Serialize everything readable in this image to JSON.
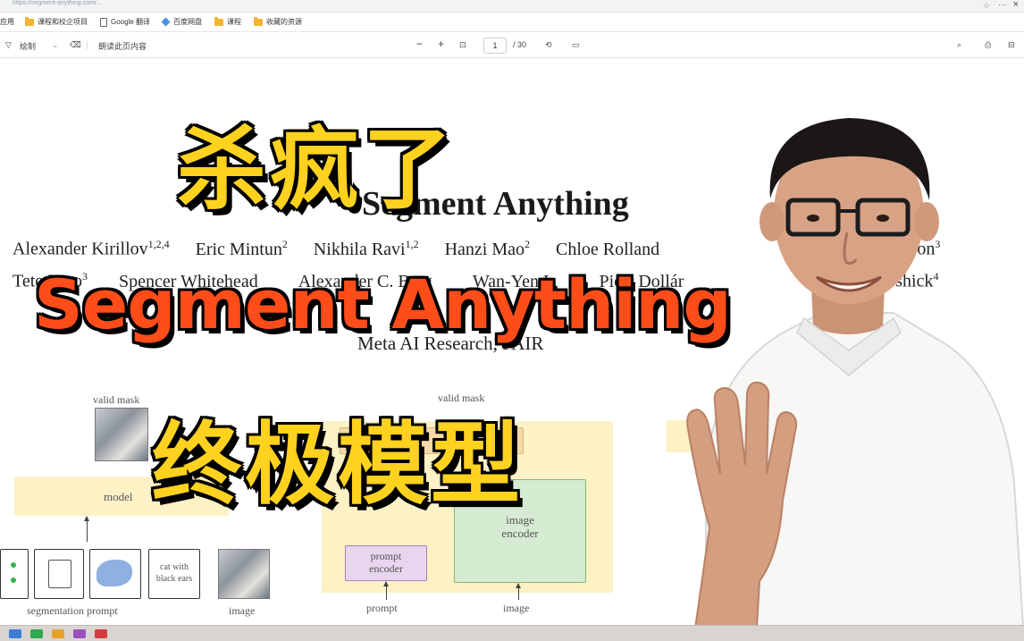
{
  "browser": {
    "url": "https://segment-anything.com/...",
    "bookmarks": [
      {
        "icon": "folder-icon",
        "label": "课程和校企项目"
      },
      {
        "icon": "doc-icon",
        "label": "Google 翻译"
      },
      {
        "icon": "diamond-icon",
        "label": "百度网盘"
      },
      {
        "icon": "folder-icon",
        "label": "课程"
      },
      {
        "icon": "folder-icon",
        "label": "收藏的资源"
      }
    ]
  },
  "pdf_toolbar": {
    "draw_label": "绘制",
    "read_aloud_label": "朗读此页内容",
    "zoom_out": "−",
    "zoom_in": "+",
    "page_current": "1",
    "page_total": "/ 30"
  },
  "paper": {
    "title": "Segment Anything",
    "authors_row1": [
      {
        "name": "Alexander Kirillov",
        "sup": "1,2,4"
      },
      {
        "name": "Eric Mintun",
        "sup": "2"
      },
      {
        "name": "Nikhila Ravi",
        "sup": "1,2"
      },
      {
        "name": "Hanzi Mao",
        "sup": "2"
      },
      {
        "name": "Chloe Rolland",
        "sup": ""
      },
      {
        "name": "afson",
        "sup": "3"
      }
    ],
    "authors_row2": [
      {
        "name": "Tete Xiao",
        "sup": "3"
      },
      {
        "name": "Spencer Whitehead",
        "sup": ""
      },
      {
        "name": "Alexander C. Berg",
        "sup": ""
      },
      {
        "name": "Wan-Yen L",
        "sup": ""
      },
      {
        "name": "Piotr Dollár",
        "sup": ""
      },
      {
        "name": "irshick",
        "sup": "4"
      }
    ],
    "affiliation": "Meta AI Research, FAIR",
    "figure": {
      "valid_mask_left": "valid mask",
      "model": "model",
      "cat_prompt": "cat with black ears",
      "valid_mask_mid": "valid mask",
      "image_encoder": "image encoder",
      "prompt_encoder": "prompt encoder",
      "segmentation_prompt": "segmentation prompt",
      "image_left": "image",
      "prompt_bottom": "prompt",
      "image_bottom": "image"
    }
  },
  "overlay": {
    "line1": "杀疯了",
    "line2": "Segment Anything",
    "line3": "终极模型"
  },
  "colors": {
    "title_yellow": "#ffd21f",
    "title_orange": "#ff4d1a",
    "figure_yellow": "#fdf1c6",
    "figure_green": "#d6ecd2",
    "figure_purple": "#e8d6ef"
  }
}
